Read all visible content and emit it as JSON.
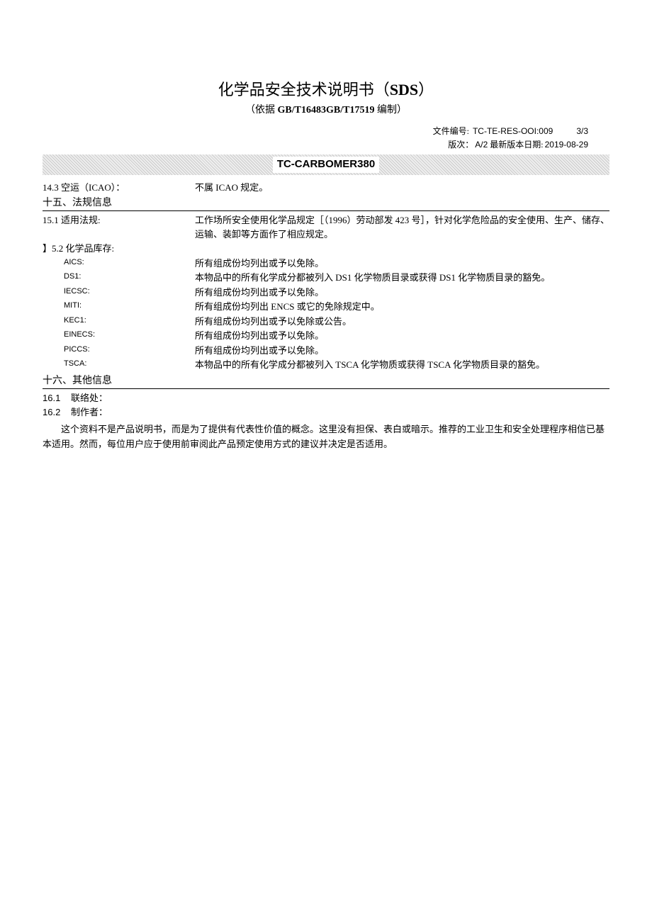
{
  "title": {
    "prefix": "化学品安全技术说明书（",
    "bold": "SDS",
    "suffix": "）"
  },
  "subtitle": {
    "prefix": "（依据 ",
    "bold": "GB/T16483GB/T17519",
    "suffix": " 编制）"
  },
  "header": {
    "doc_no_label": "文件编号:",
    "doc_no": "TC-TE-RES-OOI:009",
    "page": "3/3",
    "version_label": "版次：",
    "version": "A/2",
    "date_label": "最新版本日期:",
    "date": "2019-08-29"
  },
  "product_name": "TC-CARBOMER380",
  "section14_3": {
    "label": "14.3 空运（ICAO）：",
    "value": "不属 ICAO 规定。"
  },
  "section15": {
    "heading": "十五、法规信息",
    "item1": {
      "label": "15.1 适用法规:",
      "value": "工作场所安全使用化学品规定［（1996）劳动部发 423 号］，针对化学危险品的安全使用、生产、储存、运输、装卸等方面作了相应规定。"
    },
    "item2": {
      "label": "】5.2 化学品库存:",
      "entries": [
        {
          "label": "AICS:",
          "value": "所有组成份均列出或予以免除。"
        },
        {
          "label": "DS1:",
          "value": "本物品中的所有化学成分都被列入 DS1 化学物质目录或获得 DS1 化学物质目录的豁免。"
        },
        {
          "label": "IECSC:",
          "value": "所有组成份均列出或予以免除。"
        },
        {
          "label": "MITI:",
          "value": "所有组成份均列出 ENCS 或它的免除规定中。"
        },
        {
          "label": "KEC1:",
          "value": "所有组成份均列出或予以免除或公告。"
        },
        {
          "label": "EINECS:",
          "value": "所有组成份均列出或予以免除。"
        },
        {
          "label": "PICCS:",
          "value": "所有组成份均列出或予以免除。"
        },
        {
          "label": "TSCA:",
          "value": "本物品中的所有化学成分都被列入 TSCA 化学物质或获得 TSCA 化学物质目录的豁免。"
        }
      ]
    }
  },
  "section16": {
    "heading": "十六、其他信息",
    "item1": {
      "num": "16.1",
      "label": "联络处："
    },
    "item2": {
      "num": "16.2",
      "label": "制作者："
    },
    "disclaimer": "这个资料不是产品说明书，而是为了提供有代表性价值的概念。这里没有担保、表白或暗示。推荐的工业卫生和安全处理程序相信已基本适用。然而，每位用户应于使用前审阅此产品预定使用方式的建议并决定是否适用。"
  }
}
